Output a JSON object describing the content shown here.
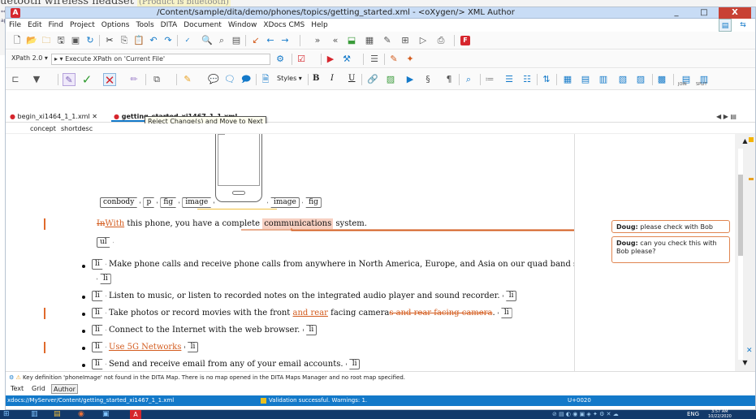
{
  "background": {
    "doc_text": "uetooth wireless headset",
    "doc_highlight": "(Product is bluetooth)",
    "left_snippet_1": "**",
    "left_snippet_2": "apl"
  },
  "window": {
    "title": "/Content/sample/dita/demo/phones/topics/getting_started.xml  - <oXygen/> XML Author",
    "logo": "A",
    "controls": {
      "minimize": "_",
      "maximize": "□",
      "close": "X"
    }
  },
  "menu": [
    "File",
    "Edit",
    "Find",
    "Project",
    "Options",
    "Tools",
    "DITA",
    "Document",
    "Window",
    "XDocs CMS",
    "Help"
  ],
  "xpath": {
    "version": "XPath 2.0 ▾",
    "scope": "▸ ▾ Execute XPath on 'Current File'"
  },
  "toolbar3": {
    "styles": "Styles ▾",
    "bold": "B",
    "italic": "I",
    "underline": "U",
    "join": "JOIN",
    "split": "SPLIT"
  },
  "tabs": {
    "tab1": "begin_xi1464_1_1.xml",
    "tab2": "getting_started_xi1467_1_1.xml",
    "nav": "◀ ▶ ▤"
  },
  "tooltip": "Reject Change(s) and Move to Next",
  "breadcrumb": [
    "concept",
    "shortdesc"
  ],
  "doc": {
    "tags_row": {
      "conbody": "conbody",
      "p": "p",
      "fig": "fig",
      "image": "image",
      "image_end": "image",
      "fig_end": "fig"
    },
    "para": {
      "deleted": "In",
      "inserted": "With",
      "text1": " this phone, you have a complete ",
      "highlight": "communications",
      "text2": " system."
    },
    "ul": "ul",
    "li": "li",
    "items": [
      "Make phone calls and receive phone calls from anywhere in North America, Europe, and Asia on our quad band system.",
      "Listen to music, or listen to recorded notes on the integrated audio player and sound recorder.",
      "Connect to the Internet with the web browser.",
      "Send and receive email from any of your email accounts."
    ],
    "photo_item": {
      "text1": "Take photos or record movies with the front ",
      "inserted": "and rear",
      "text2": " facing camera",
      "deleted": "s and rear facing camera",
      "text3": "."
    },
    "item5g": "Use 5G Networks"
  },
  "comments": [
    {
      "author": "Doug:",
      "text": " please check with Bob"
    },
    {
      "author": "Doug:",
      "text": " can you check this with Bob please?"
    }
  ],
  "message": "Key definition 'phoneImage' not found in the DITA Map. There is no map opened in the DITA Maps Manager and no root map specified.",
  "modes": [
    "Text",
    "Grid",
    "Author"
  ],
  "status": {
    "path": "xdocs://MyServer/Content/getting_started_xi1467_1_1.xml",
    "validation": "Validation successful. Warnings: 1.",
    "unicode": "U+0020"
  },
  "taskbar": {
    "lang": "ENG",
    "time": "3:57 AM",
    "date": "10/22/2020"
  },
  "colors": {
    "accent": "#1379c9",
    "change": "#d35b1d",
    "comment_border": "#e08550",
    "title": "#c8dcf5"
  }
}
